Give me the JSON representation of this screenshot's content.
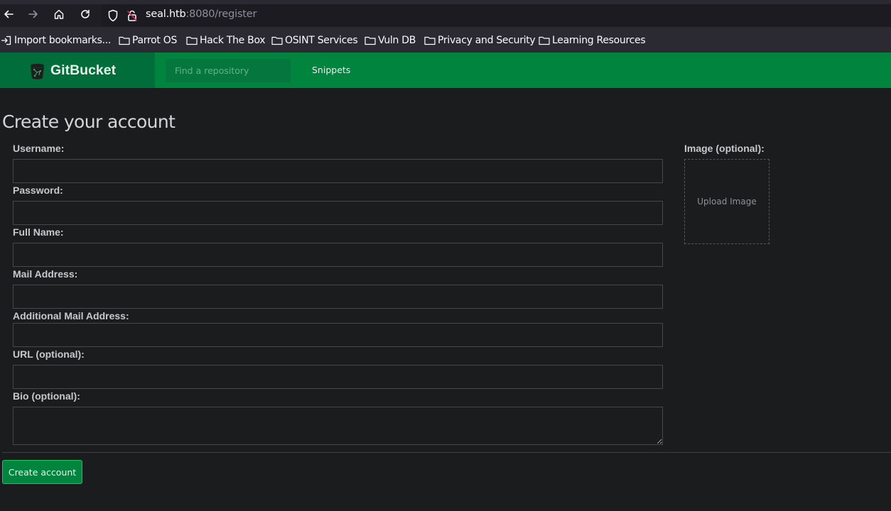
{
  "browser": {
    "url_host": "seal.htb",
    "url_rest": ":8080/register",
    "bookmarks": [
      {
        "label": "Import bookmarks...",
        "icon": "import-icon"
      },
      {
        "label": "Parrot OS",
        "icon": "folder-icon"
      },
      {
        "label": "Hack The Box",
        "icon": "folder-icon"
      },
      {
        "label": "OSINT Services",
        "icon": "folder-icon"
      },
      {
        "label": "Vuln DB",
        "icon": "folder-icon"
      },
      {
        "label": "Privacy and Security",
        "icon": "folder-icon"
      },
      {
        "label": "Learning Resources",
        "icon": "folder-icon"
      }
    ]
  },
  "header": {
    "brand": "GitBucket",
    "search_placeholder": "Find a repository",
    "nav_snippets": "Snippets"
  },
  "form": {
    "title": "Create your account",
    "fields": {
      "username": {
        "label": "Username:",
        "value": ""
      },
      "password": {
        "label": "Password:",
        "value": ""
      },
      "full_name": {
        "label": "Full Name:",
        "value": ""
      },
      "mail": {
        "label": "Mail Address:",
        "value": ""
      },
      "extra_mail": {
        "label": "Additional Mail Address:",
        "value": ""
      },
      "url": {
        "label": "URL (optional):",
        "value": ""
      },
      "bio": {
        "label": "Bio (optional):",
        "value": ""
      }
    },
    "image_label": "Image (optional):",
    "upload_label": "Upload Image",
    "submit_label": "Create account"
  },
  "colors": {
    "brand_green": "#00843e",
    "brand_dark_green": "#006d3a",
    "page_bg": "#1b1c1e"
  }
}
